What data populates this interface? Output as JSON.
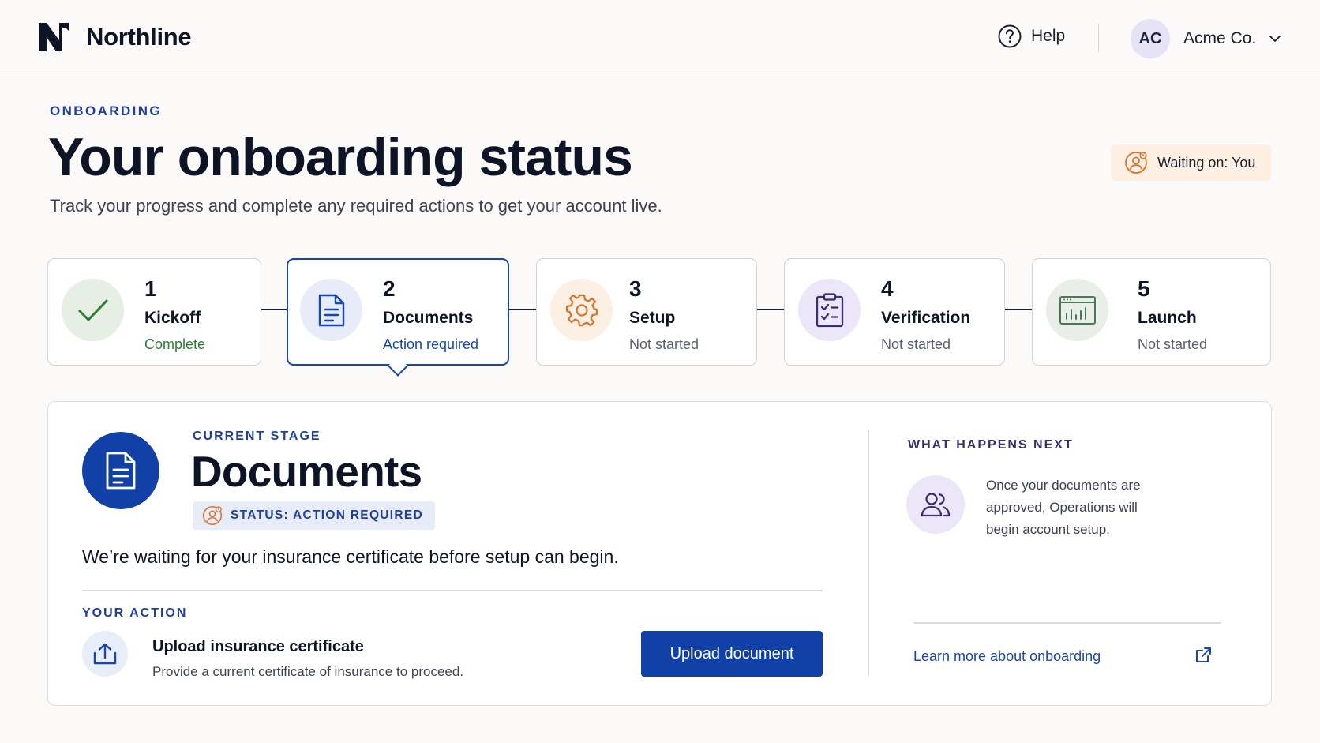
{
  "header": {
    "brand": "Northline",
    "help_label": "Help",
    "account": {
      "initials": "AC",
      "name": "Acme Co."
    }
  },
  "page": {
    "eyebrow": "ONBOARDING",
    "title": "Your onboarding status",
    "subtitle": "Track your progress and complete any required actions to get your account live.",
    "waiting_badge": "Waiting on: You"
  },
  "steps": [
    {
      "number": "1",
      "label": "Kickoff",
      "status": "Complete",
      "icon": "check-icon",
      "state": "complete"
    },
    {
      "number": "2",
      "label": "Documents",
      "status": "Action required",
      "icon": "document-icon",
      "state": "active"
    },
    {
      "number": "3",
      "label": "Setup",
      "status": "Not started",
      "icon": "gear-icon",
      "state": "pending"
    },
    {
      "number": "4",
      "label": "Verification",
      "status": "Not started",
      "icon": "clipboard-check-icon",
      "state": "pending"
    },
    {
      "number": "5",
      "label": "Launch",
      "status": "Not started",
      "icon": "dashboard-icon",
      "state": "pending"
    }
  ],
  "current_stage": {
    "eyebrow": "CURRENT STAGE",
    "title": "Documents",
    "status_pill": "STATUS: ACTION REQUIRED",
    "message": "We’re waiting for your insurance certificate before setup can begin.",
    "action_eyebrow": "YOUR ACTION",
    "action_title": "Upload insurance certificate",
    "action_description": "Provide a current certificate of insurance to proceed.",
    "action_button": "Upload document"
  },
  "next": {
    "eyebrow": "WHAT HAPPENS NEXT",
    "text": "Once your documents are approved, Operations will begin account setup.",
    "link": "Learn more about onboarding"
  },
  "colors": {
    "primary": "#1140a6",
    "accent_text": "#1f3f9c",
    "complete_green": "#2e7d32",
    "warning_orange": "#d9732b",
    "background": "#fbfaf8"
  }
}
